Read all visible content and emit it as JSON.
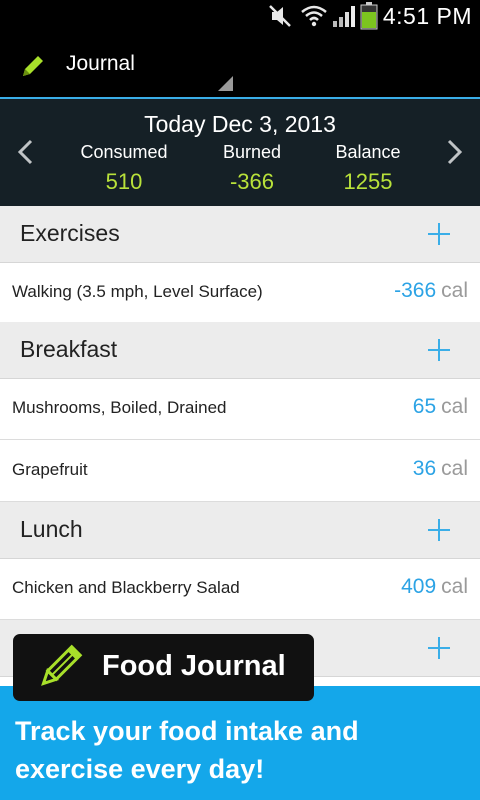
{
  "status": {
    "time": "4:51 PM"
  },
  "actionbar": {
    "title": "Journal"
  },
  "summary": {
    "date": "Today Dec 3, 2013",
    "consumed_label": "Consumed",
    "consumed_value": "510",
    "burned_label": "Burned",
    "burned_value": "-366",
    "balance_label": "Balance",
    "balance_value": "1255"
  },
  "sections": {
    "exercises": {
      "title": "Exercises"
    },
    "breakfast": {
      "title": "Breakfast"
    },
    "lunch": {
      "title": "Lunch"
    }
  },
  "rows": {
    "walking": {
      "name": "Walking (3.5 mph, Level Surface)",
      "cal": "-366",
      "unit": "cal"
    },
    "mushrooms": {
      "name": "Mushrooms, Boiled, Drained",
      "cal": "65",
      "unit": "cal"
    },
    "grapefruit": {
      "name": "Grapefruit",
      "cal": "36",
      "unit": "cal"
    },
    "chicken": {
      "name": "Chicken and Blackberry Salad",
      "cal": "409",
      "unit": "cal"
    }
  },
  "promo": {
    "badge": "Food Journal",
    "line1": "Track your food intake and",
    "line2": "exercise every day!"
  },
  "colors": {
    "accent": "#3aaee8",
    "value_green": "#b9e23a",
    "promo_blue": "#14a7ea"
  }
}
